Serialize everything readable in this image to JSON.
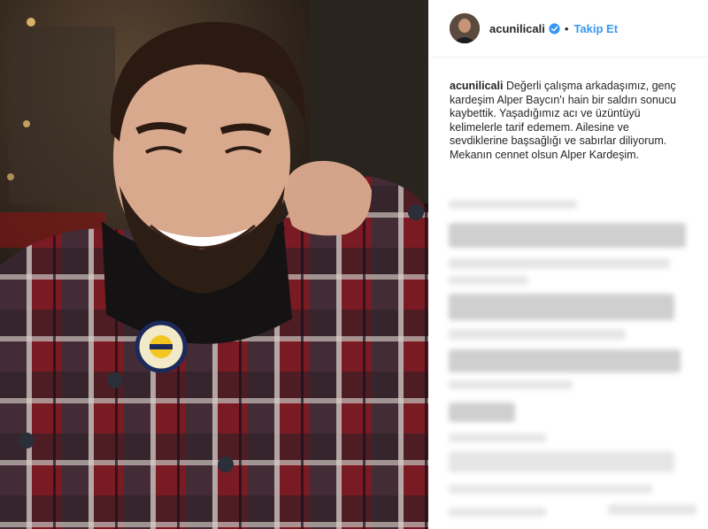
{
  "post": {
    "username": "acunilicali",
    "follow_label": "Takip Et",
    "separator": "•",
    "verified_icon": "verified-badge-icon",
    "caption_user": "acunilicali",
    "caption_text": "Değerli çalışma arkadaşımız, genç kardeşim Alper Baycın'ı hain bir saldırı sonucu kaybettik. Yaşadığımız acı ve üzüntüyü kelimelerle tarif edemem. Ailesine ve sevdiklerine başsağlığı ve sabırlar diliyorum. Mekanın cennet olsun Alper Kardeşim."
  },
  "colors": {
    "accent": "#3897f0",
    "text": "#262626",
    "border": "#efefef"
  }
}
